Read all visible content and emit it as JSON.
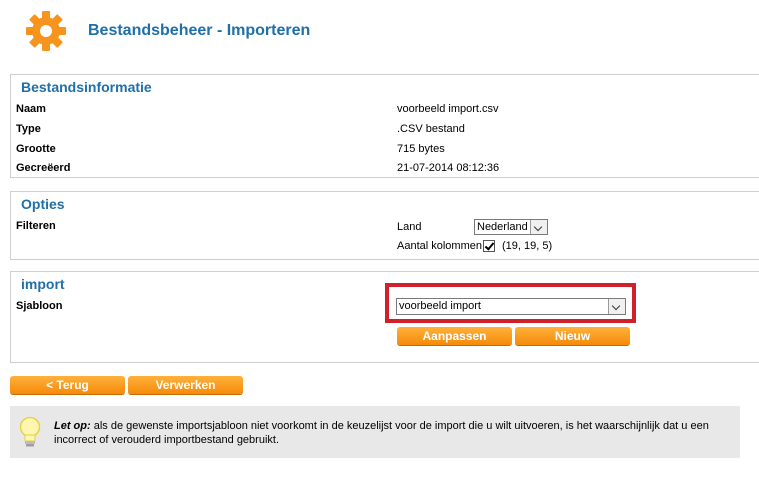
{
  "header": {
    "title": "Bestandsbeheer - Importeren",
    "icon": "gear-icon",
    "icon_color": "#f7941d"
  },
  "bestandsinformatie": {
    "title": "Bestandsinformatie",
    "rows": [
      {
        "label": "Naam",
        "value": "voorbeeld import.csv"
      },
      {
        "label": "Type",
        "value": ".CSV bestand"
      },
      {
        "label": "Grootte",
        "value": "715 bytes"
      },
      {
        "label": "Gecreëerd",
        "value": "21-07-2014 08:12:36"
      }
    ]
  },
  "opties": {
    "title": "Opties",
    "filter_label": "Filteren",
    "land_label": "Land",
    "land_value": "Nederland",
    "kolommen_label": "Aantal kolommen",
    "kolommen_checked": true,
    "kolommen_info": "(19, 19, 5)"
  },
  "import": {
    "title": "import",
    "sjabloon_label": "Sjabloon",
    "sjabloon_value": "voorbeeld import",
    "aanpassen_label": "Aanpassen",
    "nieuw_label": "Nieuw"
  },
  "actions": {
    "back_label": "< Terug",
    "process_label": "Verwerken"
  },
  "note": {
    "icon": "lightbulb-icon",
    "prefix": "Let op:",
    "text": " als de gewenste importsjabloon niet voorkomt in de keuzelijst voor de import die u wilt uitvoeren, is het waarschijnlijk dat u een incorrect of verouderd importbestand gebruikt."
  },
  "colors": {
    "accent": "#1f6fa8",
    "button": "#f58a0a",
    "highlight": "#d0202a"
  }
}
